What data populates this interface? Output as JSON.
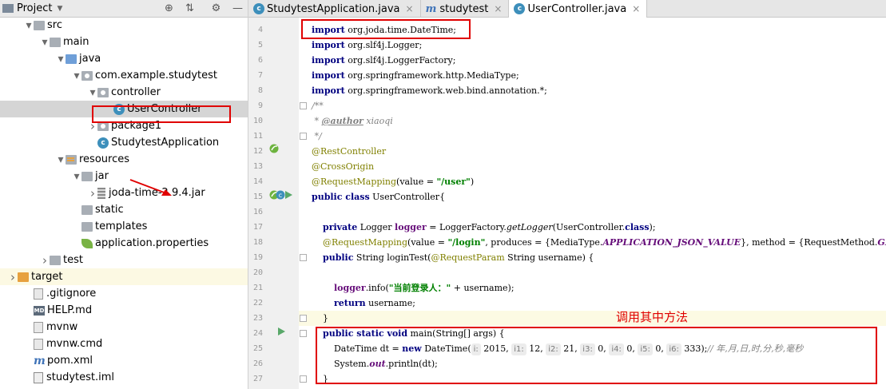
{
  "project_panel": {
    "title": "Project",
    "tree": [
      {
        "label": "src",
        "depth": 1,
        "icon": "folder-gray",
        "arrow": "open"
      },
      {
        "label": "main",
        "depth": 2,
        "icon": "folder-gray",
        "arrow": "open"
      },
      {
        "label": "java",
        "depth": 3,
        "icon": "folder-blue",
        "arrow": "open"
      },
      {
        "label": "com.example.studytest",
        "depth": 4,
        "icon": "folder-pkg",
        "arrow": "open"
      },
      {
        "label": "controller",
        "depth": 5,
        "icon": "folder-pkg",
        "arrow": "open"
      },
      {
        "label": "UserController",
        "depth": 6,
        "icon": "class",
        "arrow": "none",
        "selected": true
      },
      {
        "label": "package1",
        "depth": 5,
        "icon": "folder-pkg",
        "arrow": "closed"
      },
      {
        "label": "StudytestApplication",
        "depth": 5,
        "icon": "class",
        "arrow": "none"
      },
      {
        "label": "resources",
        "depth": 3,
        "icon": "folder-res",
        "arrow": "open"
      },
      {
        "label": "jar",
        "depth": 4,
        "icon": "folder-gray",
        "arrow": "open"
      },
      {
        "label": "joda-time-2.9.4.jar",
        "depth": 5,
        "icon": "jar",
        "arrow": "closed"
      },
      {
        "label": "static",
        "depth": 4,
        "icon": "folder-gray",
        "arrow": "none"
      },
      {
        "label": "templates",
        "depth": 4,
        "icon": "folder-gray",
        "arrow": "none"
      },
      {
        "label": "application.properties",
        "depth": 4,
        "icon": "leaf",
        "arrow": "none"
      },
      {
        "label": "test",
        "depth": 2,
        "icon": "folder-gray",
        "arrow": "closed"
      },
      {
        "label": "target",
        "depth": 0,
        "icon": "folder-orange",
        "arrow": "closed",
        "highlight": true
      },
      {
        "label": ".gitignore",
        "depth": 1,
        "icon": "file",
        "arrow": "none"
      },
      {
        "label": "HELP.md",
        "depth": 1,
        "icon": "md",
        "arrow": "none"
      },
      {
        "label": "mvnw",
        "depth": 1,
        "icon": "file",
        "arrow": "none"
      },
      {
        "label": "mvnw.cmd",
        "depth": 1,
        "icon": "file",
        "arrow": "none"
      },
      {
        "label": "pom.xml",
        "depth": 1,
        "icon": "m",
        "arrow": "none"
      },
      {
        "label": "studytest.iml",
        "depth": 1,
        "icon": "iml",
        "arrow": "none"
      }
    ]
  },
  "tabs": [
    {
      "label": "StudytestApplication.java",
      "icon": "class",
      "active": false
    },
    {
      "label": "studytest",
      "icon": "m",
      "active": false
    },
    {
      "label": "UserController.java",
      "icon": "class",
      "active": true
    }
  ],
  "code": {
    "line_numbers": [
      "4",
      "5",
      "6",
      "7",
      "8",
      "9",
      "10",
      "11",
      "12",
      "13",
      "14",
      "15",
      "16",
      "17",
      "18",
      "19",
      "20",
      "21",
      "22",
      "23",
      "24",
      "25",
      "26",
      "27"
    ],
    "lines": [
      {
        "segments": [
          {
            "t": "import",
            "c": "kw"
          },
          {
            "t": " org.joda.time.DateTime;"
          }
        ]
      },
      {
        "segments": [
          {
            "t": "import",
            "c": "kw"
          },
          {
            "t": " org.slf4j.Logger;"
          }
        ]
      },
      {
        "segments": [
          {
            "t": "import",
            "c": "kw"
          },
          {
            "t": " org.slf4j.LoggerFactory;"
          }
        ]
      },
      {
        "segments": [
          {
            "t": "import",
            "c": "kw"
          },
          {
            "t": " org.springframework.http.MediaType;"
          }
        ]
      },
      {
        "segments": [
          {
            "t": "import",
            "c": "kw"
          },
          {
            "t": " org.springframework.web.bind.annotation.*;"
          }
        ]
      },
      {
        "segments": [
          {
            "t": "/**",
            "c": "cmt"
          }
        ]
      },
      {
        "segments": [
          {
            "t": " * ",
            "c": "cmt"
          },
          {
            "t": "@author",
            "c": "doctag"
          },
          {
            "t": " xiaoqi",
            "c": "cmt"
          }
        ]
      },
      {
        "segments": [
          {
            "t": " */",
            "c": "cmt"
          }
        ]
      },
      {
        "segments": [
          {
            "t": "@RestController",
            "c": "ann"
          }
        ]
      },
      {
        "segments": [
          {
            "t": "@CrossOrigin",
            "c": "ann"
          }
        ]
      },
      {
        "segments": [
          {
            "t": "@RequestMapping",
            "c": "ann"
          },
          {
            "t": "(value = "
          },
          {
            "t": "\"/user\"",
            "c": "str"
          },
          {
            "t": ")"
          }
        ]
      },
      {
        "segments": [
          {
            "t": "public class",
            "c": "kw"
          },
          {
            "t": " UserController{"
          }
        ]
      },
      {
        "segments": []
      },
      {
        "segments": [
          {
            "t": "    "
          },
          {
            "t": "private",
            "c": "kw"
          },
          {
            "t": " Logger "
          },
          {
            "t": "logger",
            "c": "field"
          },
          {
            "t": " = LoggerFactory."
          },
          {
            "t": "getLogger",
            "c": "itl"
          },
          {
            "t": "(UserController."
          },
          {
            "t": "class",
            "c": "kw"
          },
          {
            "t": ");"
          }
        ]
      },
      {
        "segments": [
          {
            "t": "    "
          },
          {
            "t": "@RequestMapping",
            "c": "ann"
          },
          {
            "t": "(value = "
          },
          {
            "t": "\"/login\"",
            "c": "str"
          },
          {
            "t": ", produces = {MediaType."
          },
          {
            "t": "APPLICATION_JSON_VALUE",
            "c": "stat"
          },
          {
            "t": "}, method = {RequestMethod."
          },
          {
            "t": "GET",
            "c": "stat"
          },
          {
            "t": "})"
          }
        ]
      },
      {
        "segments": [
          {
            "t": "    "
          },
          {
            "t": "public",
            "c": "kw"
          },
          {
            "t": " String loginTest("
          },
          {
            "t": "@RequestParam",
            "c": "ann"
          },
          {
            "t": " String username) {"
          }
        ]
      },
      {
        "segments": []
      },
      {
        "segments": [
          {
            "t": "        "
          },
          {
            "t": "logger",
            "c": "field"
          },
          {
            "t": ".info("
          },
          {
            "t": "\"当前登录人：\"",
            "c": "str"
          },
          {
            "t": " + username);"
          }
        ]
      },
      {
        "segments": [
          {
            "t": "        "
          },
          {
            "t": "return",
            "c": "kw"
          },
          {
            "t": " username;"
          }
        ]
      },
      {
        "segments": [
          {
            "t": "    }"
          }
        ]
      },
      {
        "segments": [
          {
            "t": "    "
          },
          {
            "t": "public static void",
            "c": "kw"
          },
          {
            "t": " main(String[] args) {"
          }
        ]
      },
      {
        "segments": [
          {
            "t": "        DateTime dt = "
          },
          {
            "t": "new",
            "c": "kw"
          },
          {
            "t": " DateTime("
          },
          {
            "t": "i:",
            "c": "hint"
          },
          {
            "t": " 2015, "
          },
          {
            "t": "i1:",
            "c": "hint"
          },
          {
            "t": " 12, "
          },
          {
            "t": "i2:",
            "c": "hint"
          },
          {
            "t": " 21, "
          },
          {
            "t": "i3:",
            "c": "hint"
          },
          {
            "t": " 0, "
          },
          {
            "t": "i4:",
            "c": "hint"
          },
          {
            "t": " 0, "
          },
          {
            "t": "i5:",
            "c": "hint"
          },
          {
            "t": " 0, "
          },
          {
            "t": "i6:",
            "c": "hint"
          },
          {
            "t": " 333);"
          },
          {
            "t": "// 年,月,日,时,分,秒,毫秒",
            "c": "cmt"
          }
        ]
      },
      {
        "segments": [
          {
            "t": "        System."
          },
          {
            "t": "out",
            "c": "stat"
          },
          {
            "t": ".println(dt);"
          }
        ]
      },
      {
        "segments": [
          {
            "t": "    }"
          }
        ]
      }
    ]
  },
  "annotation_note": "调用其中方法",
  "colors": {
    "red_annotation": "#e00000",
    "keyword": "#000080",
    "string": "#008000",
    "annotation": "#808000",
    "comment": "#808080"
  }
}
